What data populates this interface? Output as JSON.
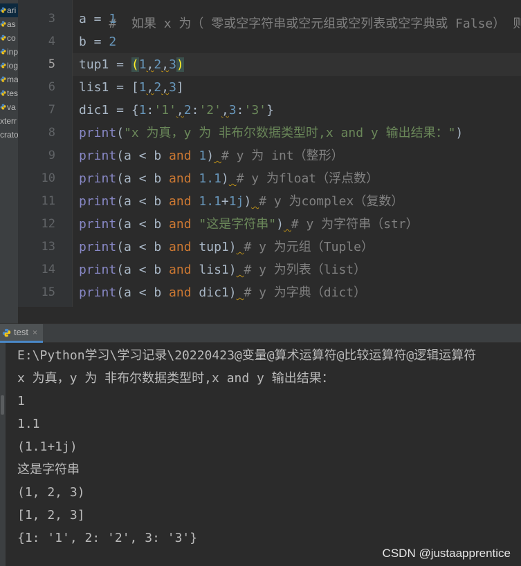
{
  "project": {
    "items": [
      "ari",
      "as",
      "co",
      "inp",
      "log",
      "ma",
      "tes",
      "va",
      "xterr",
      "crato"
    ]
  },
  "editor": {
    "top_partial": "#  如果 x 为（ 零或空字符串或空元组或空列表或空字典或 False） 则返",
    "lines": [
      {
        "n": "3",
        "tokens": [
          [
            "",
            "a = "
          ],
          [
            "num",
            "1"
          ]
        ]
      },
      {
        "n": "4",
        "tokens": [
          [
            "",
            "b = "
          ],
          [
            "num",
            "2"
          ]
        ]
      },
      {
        "n": "5",
        "tokens": [
          [
            "",
            "tup1 = "
          ],
          [
            "brhl",
            "("
          ],
          [
            "num",
            "1"
          ],
          [
            "sq",
            ","
          ],
          [
            "num",
            "2"
          ],
          [
            "sq",
            ","
          ],
          [
            "num",
            "3"
          ],
          [
            "brhl",
            ")"
          ]
        ]
      },
      {
        "n": "6",
        "tokens": [
          [
            "",
            "lis1 = ["
          ],
          [
            "num",
            "1"
          ],
          [
            "sq",
            ","
          ],
          [
            "num",
            "2"
          ],
          [
            "sq",
            ","
          ],
          [
            "num",
            "3"
          ],
          [
            "",
            "]"
          ]
        ]
      },
      {
        "n": "7",
        "tokens": [
          [
            "",
            "dic1 = {"
          ],
          [
            "num",
            "1"
          ],
          [
            "",
            ":"
          ],
          [
            "str",
            "'1'"
          ],
          [
            "sq",
            ","
          ],
          [
            "num",
            "2"
          ],
          [
            "",
            ":"
          ],
          [
            "str",
            "'2'"
          ],
          [
            "sq",
            ","
          ],
          [
            "num",
            "3"
          ],
          [
            "",
            ":"
          ],
          [
            "str",
            "'3'"
          ],
          [
            "",
            "}"
          ]
        ]
      },
      {
        "n": "8",
        "tokens": [
          [
            "fn",
            "print"
          ],
          [
            "",
            "("
          ],
          [
            "str",
            "\"x 为真，y 为 非布尔数据类型时,x and y 输出结果：\""
          ],
          [
            "",
            ")"
          ]
        ]
      },
      {
        "n": "9",
        "tokens": [
          [
            "fn",
            "print"
          ],
          [
            "",
            "(a < b "
          ],
          [
            "kw",
            "and"
          ],
          [
            "",
            " "
          ],
          [
            "num",
            "1"
          ],
          [
            "",
            ")"
          ],
          [
            "sq",
            " "
          ],
          [
            "cmt",
            "# y 为 int（整形）"
          ]
        ]
      },
      {
        "n": "10",
        "tokens": [
          [
            "fn",
            "print"
          ],
          [
            "",
            "(a < b "
          ],
          [
            "kw",
            "and"
          ],
          [
            "",
            " "
          ],
          [
            "num",
            "1.1"
          ],
          [
            "",
            ")"
          ],
          [
            "sq",
            " "
          ],
          [
            "cmt",
            "# y 为float（浮点数）"
          ]
        ]
      },
      {
        "n": "11",
        "tokens": [
          [
            "fn",
            "print"
          ],
          [
            "",
            "(a < b "
          ],
          [
            "kw",
            "and"
          ],
          [
            "",
            " "
          ],
          [
            "num",
            "1.1"
          ],
          [
            "",
            "+"
          ],
          [
            "num",
            "1j"
          ],
          [
            "",
            ")"
          ],
          [
            "sq",
            " "
          ],
          [
            "cmt",
            "# y 为complex（复数）"
          ]
        ]
      },
      {
        "n": "12",
        "tokens": [
          [
            "fn",
            "print"
          ],
          [
            "",
            "(a < b "
          ],
          [
            "kw",
            "and"
          ],
          [
            "",
            " "
          ],
          [
            "str",
            "\"这是字符串\""
          ],
          [
            "",
            ")"
          ],
          [
            "sq",
            " "
          ],
          [
            "cmt",
            "# y 为字符串（str）"
          ]
        ]
      },
      {
        "n": "13",
        "tokens": [
          [
            "fn",
            "print"
          ],
          [
            "",
            "(a < b "
          ],
          [
            "kw",
            "and"
          ],
          [
            "",
            " tup1)"
          ],
          [
            "sq",
            " "
          ],
          [
            "cmt",
            "# y 为元组（Tuple）"
          ]
        ]
      },
      {
        "n": "14",
        "tokens": [
          [
            "fn",
            "print"
          ],
          [
            "",
            "(a < b "
          ],
          [
            "kw",
            "and"
          ],
          [
            "",
            " lis1)"
          ],
          [
            "sq",
            " "
          ],
          [
            "cmt",
            "# y 为列表（list）"
          ]
        ]
      },
      {
        "n": "15",
        "tokens": [
          [
            "fn",
            "print"
          ],
          [
            "",
            "(a < b "
          ],
          [
            "kw",
            "and"
          ],
          [
            "",
            " dic1)"
          ],
          [
            "sq",
            " "
          ],
          [
            "cmt",
            "# y 为字典（dict）"
          ]
        ]
      }
    ],
    "current_line": "5"
  },
  "run": {
    "tab_label": "test",
    "close_glyph": "×",
    "output": [
      "E:\\Python学习\\学习记录\\20220423@变量@算术运算符@比较运算符@逻辑运算符",
      "x 为真，y 为 非布尔数据类型时,x and y 输出结果：",
      "1",
      "1.1",
      "(1.1+1j)",
      "这是字符串",
      "(1, 2, 3)",
      "[1, 2, 3]",
      "{1: '1', 2: '2', 3: '3'}"
    ]
  },
  "watermark": "CSDN @justaapprentice",
  "colors": {
    "keyword": "#cc7832",
    "builtin": "#8888c6",
    "number": "#6897bb",
    "string": "#6a8759",
    "comment": "#808080",
    "text": "#a9b7c6",
    "background": "#2b2b2b"
  }
}
